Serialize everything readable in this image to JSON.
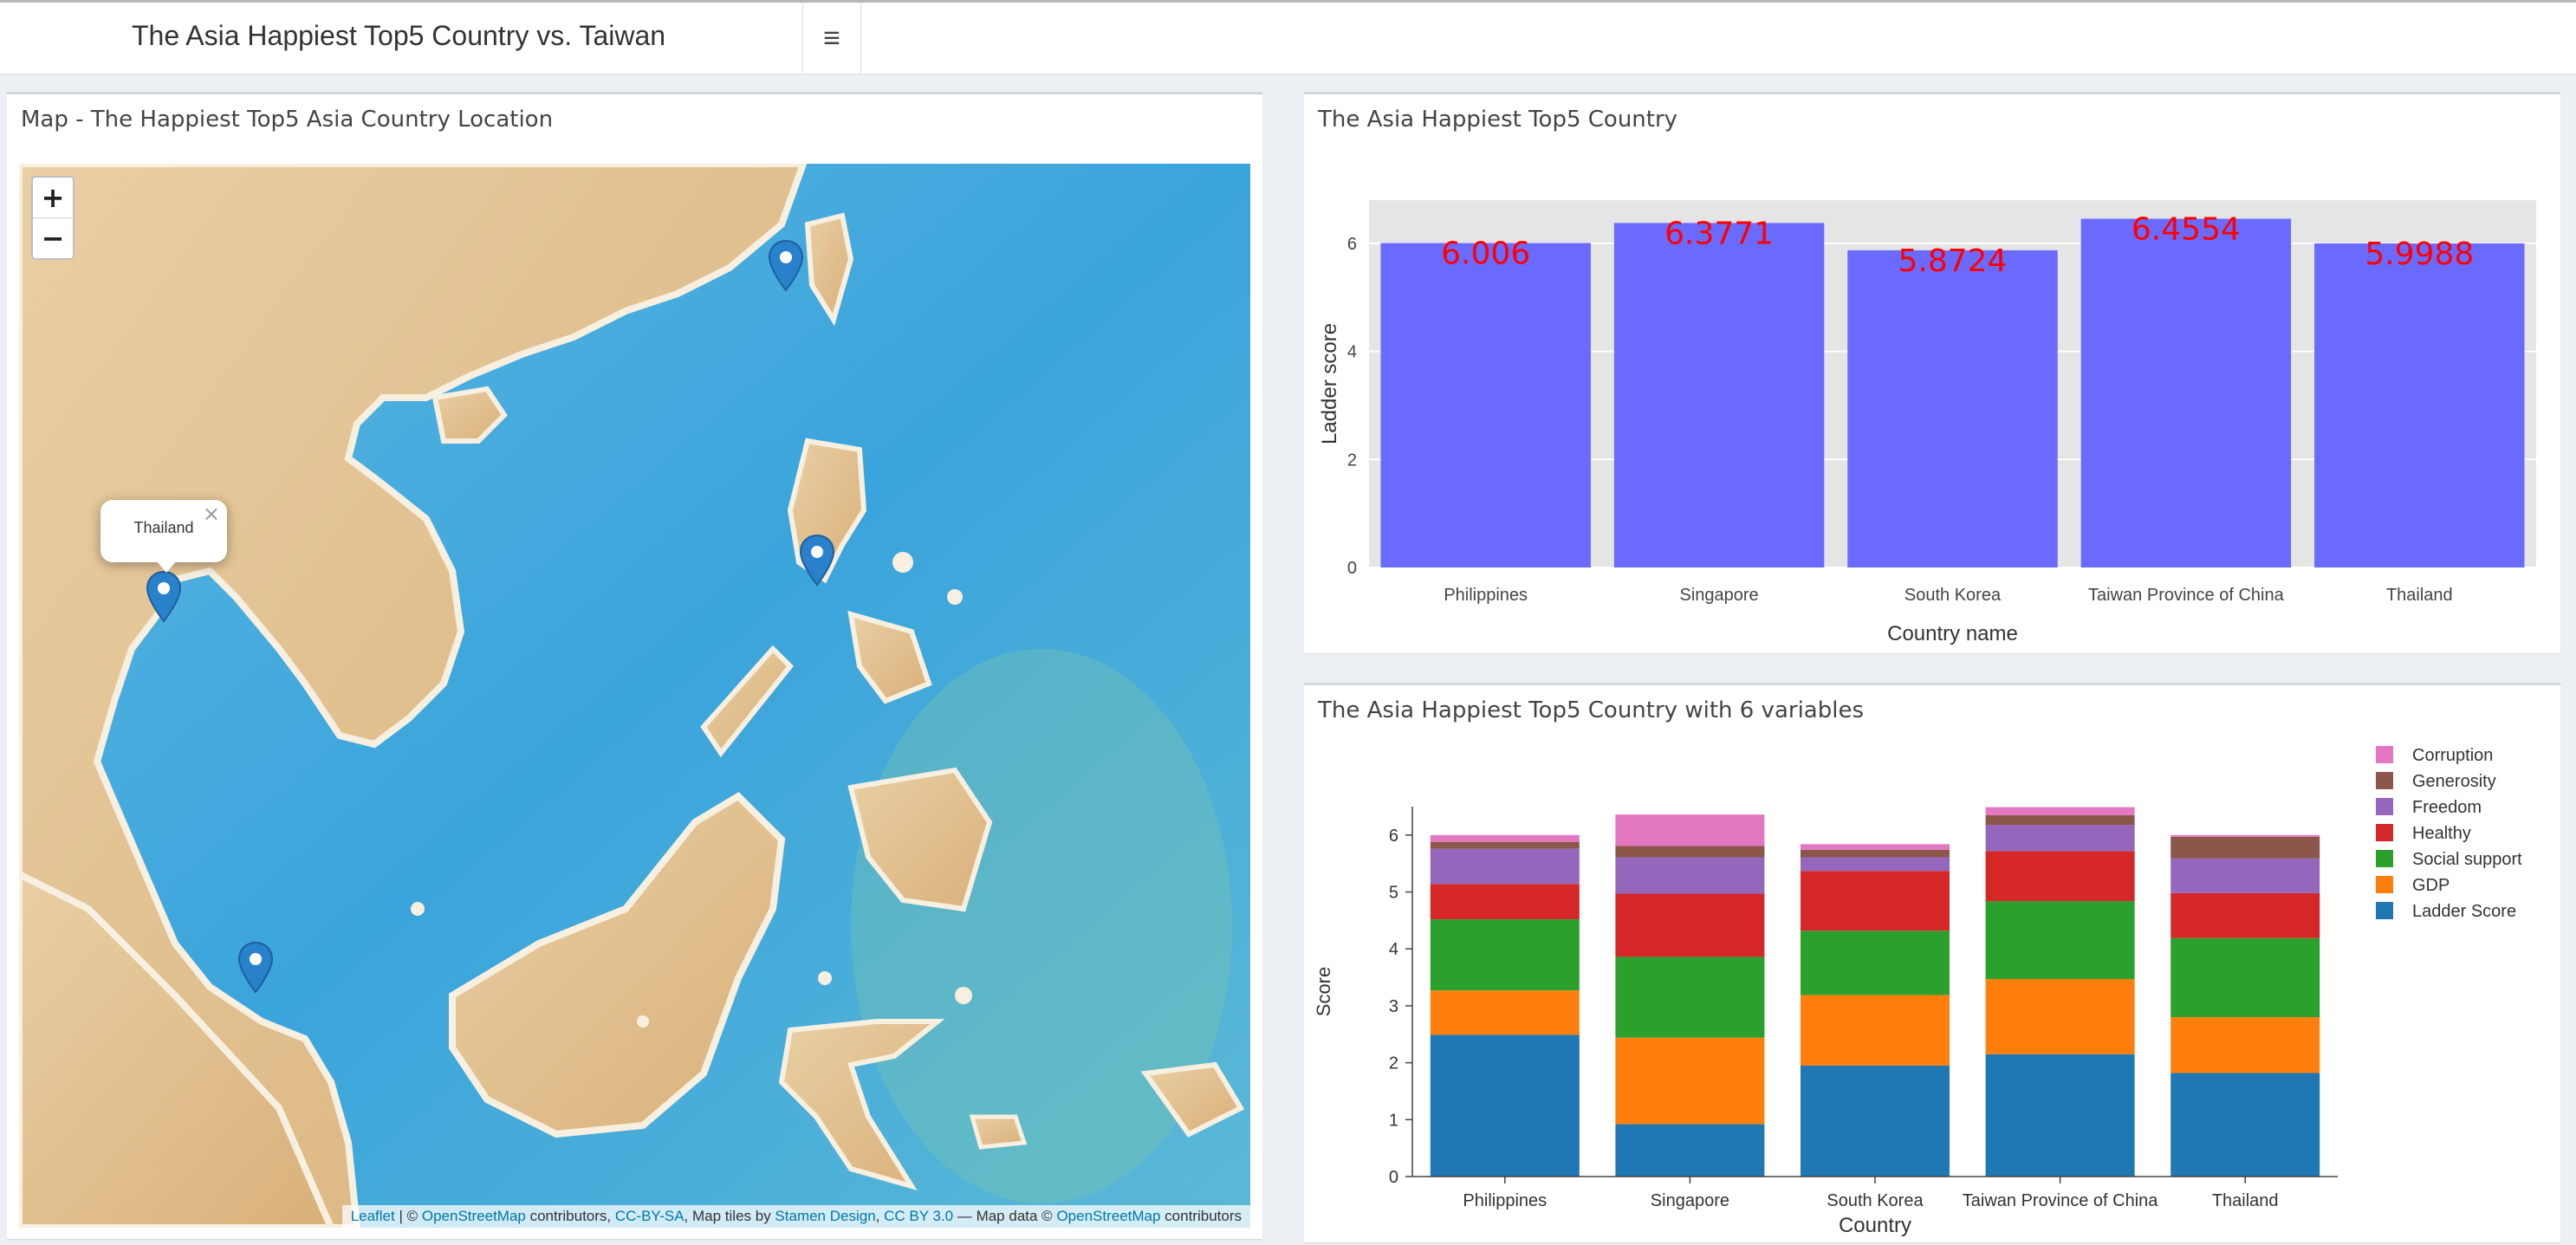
{
  "header": {
    "title": "The Asia Happiest Top5 Country vs. Taiwan",
    "menu_icon": "hamburger-icon"
  },
  "map_panel": {
    "title": "Map - The Happiest Top5 Asia Country Location",
    "zoom_in": "+",
    "zoom_out": "−",
    "popup": {
      "text": "Thailand",
      "close": "×"
    },
    "attribution": {
      "leaflet": "Leaflet",
      "sep1": " | © ",
      "osm1": "OpenStreetMap",
      "t1": " contributors, ",
      "ccbysa": "CC-BY-SA",
      "t2": ", Map tiles by ",
      "stamen": "Stamen Design",
      "t3": ", ",
      "ccby": "CC BY 3.0",
      "t4": " — Map data © ",
      "osm2": "OpenStreetMap",
      "t5": " contributors"
    },
    "markers": [
      "Taiwan",
      "Philippines",
      "Thailand",
      "Singapore"
    ]
  },
  "bar_panel": {
    "title": "The Asia Happiest Top5 Country"
  },
  "stack_panel": {
    "title": "The Asia Happiest Top5 Country with 6 variables"
  },
  "colors": {
    "bar": "#6a6aff",
    "bar_label": "#ff0000",
    "series": [
      "#1f77b4",
      "#ff7f0e",
      "#2ca02c",
      "#d62728",
      "#9467bd",
      "#8c564b",
      "#e377c2"
    ]
  },
  "chart_data": [
    {
      "type": "bar",
      "xlabel": "Country name",
      "ylabel": "Ladder score",
      "categories": [
        "Philippines",
        "Singapore",
        "South Korea",
        "Taiwan Province of China",
        "Thailand"
      ],
      "values": [
        6.006,
        6.3771,
        5.8724,
        6.4554,
        5.9988
      ],
      "value_labels": [
        "6.006",
        "6.3771",
        "5.8724",
        "6.4554",
        "5.9988"
      ],
      "yticks": [
        0,
        2,
        4,
        6
      ],
      "ylim": [
        0,
        6.8
      ],
      "grid": true
    },
    {
      "type": "bar",
      "stacked": true,
      "xlabel": "Country",
      "ylabel": "Score",
      "categories": [
        "Philippines",
        "Singapore",
        "South Korea",
        "Taiwan Province of China",
        "Thailand"
      ],
      "yticks": [
        0,
        1,
        2,
        3,
        4,
        5,
        6
      ],
      "ylim": [
        0,
        6.5
      ],
      "legend_position": "right",
      "series": [
        {
          "name": "Ladder Score",
          "values": [
            2.49,
            0.92,
            1.95,
            2.15,
            1.82
          ]
        },
        {
          "name": "GDP",
          "values": [
            0.78,
            1.52,
            1.24,
            1.32,
            0.98
          ]
        },
        {
          "name": "Social support",
          "values": [
            1.25,
            1.42,
            1.13,
            1.37,
            1.39
          ]
        },
        {
          "name": "Healthy",
          "values": [
            0.62,
            1.11,
            1.05,
            0.88,
            0.79
          ]
        },
        {
          "name": "Freedom",
          "values": [
            0.62,
            0.64,
            0.24,
            0.46,
            0.61
          ]
        },
        {
          "name": "Generosity",
          "values": [
            0.12,
            0.2,
            0.13,
            0.17,
            0.38
          ]
        },
        {
          "name": "Corruption",
          "values": [
            0.12,
            0.55,
            0.1,
            0.14,
            0.03
          ]
        }
      ]
    }
  ]
}
